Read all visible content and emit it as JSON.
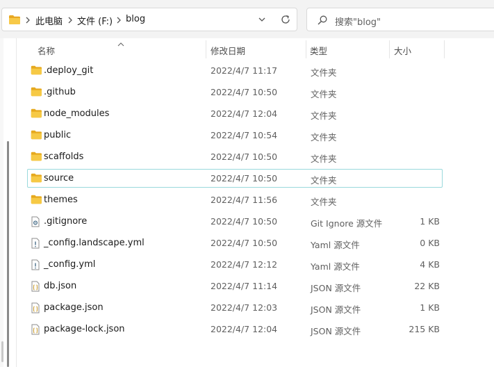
{
  "address_bar": {
    "breadcrumbs": [
      {
        "label": "此电脑"
      },
      {
        "label": "文件 (F:)"
      },
      {
        "label": "blog"
      }
    ]
  },
  "search": {
    "placeholder": "搜索\"blog\""
  },
  "columns": {
    "name": "名称",
    "date": "修改日期",
    "type": "类型",
    "size": "大小"
  },
  "files": [
    {
      "name": ".deploy_git",
      "date": "2022/4/7 11:17",
      "type": "文件夹",
      "size": "",
      "icon": "folder-icon"
    },
    {
      "name": ".github",
      "date": "2022/4/7 10:50",
      "type": "文件夹",
      "size": "",
      "icon": "folder-icon"
    },
    {
      "name": "node_modules",
      "date": "2022/4/7 12:04",
      "type": "文件夹",
      "size": "",
      "icon": "folder-icon"
    },
    {
      "name": "public",
      "date": "2022/4/7 10:54",
      "type": "文件夹",
      "size": "",
      "icon": "folder-icon"
    },
    {
      "name": "scaffolds",
      "date": "2022/4/7 10:50",
      "type": "文件夹",
      "size": "",
      "icon": "folder-icon"
    },
    {
      "name": "source",
      "date": "2022/4/7 10:50",
      "type": "文件夹",
      "size": "",
      "icon": "folder-icon"
    },
    {
      "name": "themes",
      "date": "2022/4/7 11:56",
      "type": "文件夹",
      "size": "",
      "icon": "folder-icon"
    },
    {
      "name": ".gitignore",
      "date": "2022/4/7 10:50",
      "type": "Git Ignore 源文件",
      "size": "1 KB",
      "icon": "gear-file-icon"
    },
    {
      "name": "_config.landscape.yml",
      "date": "2022/4/7 10:50",
      "type": "Yaml 源文件",
      "size": "0 KB",
      "icon": "exclamation-file-icon"
    },
    {
      "name": "_config.yml",
      "date": "2022/4/7 12:12",
      "type": "Yaml 源文件",
      "size": "4 KB",
      "icon": "exclamation-file-icon"
    },
    {
      "name": "db.json",
      "date": "2022/4/7 11:14",
      "type": "JSON 源文件",
      "size": "22 KB",
      "icon": "json-file-icon"
    },
    {
      "name": "package.json",
      "date": "2022/4/7 12:03",
      "type": "JSON 源文件",
      "size": "1 KB",
      "icon": "json-file-icon"
    },
    {
      "name": "package-lock.json",
      "date": "2022/4/7 12:04",
      "type": "JSON 源文件",
      "size": "215 KB",
      "icon": "json-file-icon"
    }
  ],
  "focused_item": "source",
  "colors": {
    "folder": "#f2c14e",
    "focus_border": "#99d9dc"
  }
}
